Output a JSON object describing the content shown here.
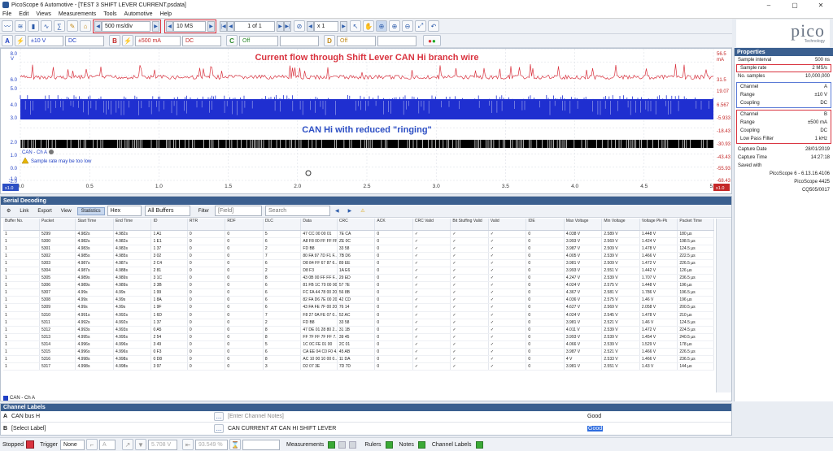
{
  "window": {
    "title": "PicoScope 6 Automotive - [TEST 3 SHIFT LEVER CURRENT.psdata]",
    "minimize": "–",
    "maximize": "▢",
    "close": "✕"
  },
  "menu": [
    "File",
    "Edit",
    "Views",
    "Measurements",
    "Tools",
    "Automotive",
    "Help"
  ],
  "toolbar": {
    "timebase": "500 ms/div",
    "samples": "10 MS",
    "page": "1 of 1",
    "zoom": "x 1"
  },
  "channels": {
    "a": {
      "letter": "A",
      "range": "±10 V",
      "coupling": "DC"
    },
    "b": {
      "letter": "B",
      "range": "±500 mA",
      "coupling": "DC"
    },
    "c": {
      "value": "Off"
    },
    "d": {
      "value": "Off"
    }
  },
  "scope": {
    "title_b": "Current flow through Shift Lever CAN Hi branch wire",
    "title_a": "CAN Hi with reduced \"ringing\"",
    "left_unit": "V",
    "right_unit": "mA",
    "left_ticks": [
      "8.0",
      "6.0",
      "5.0",
      "4.0",
      "3.0",
      "2.0",
      "1.0",
      "0.0",
      "-1.0",
      "-2.0"
    ],
    "right_ticks": [
      "56.5",
      "31.5",
      "19.07",
      "6.567",
      "-5.933",
      "-18.43",
      "-30.93",
      "-43.43",
      "-55.93",
      "-68.43"
    ],
    "x_ticks": [
      "0.0",
      "0.5",
      "1.0",
      "1.5",
      "2.0",
      "2.5",
      "3.0",
      "3.5",
      "4.0",
      "4.5",
      "5.0"
    ],
    "x_unit": "s",
    "decode_label": "CAN - Ch A",
    "warning": "Sample rate may be too low",
    "axis_left_badge": "x1.0",
    "axis_right_badge": "x1.0"
  },
  "logo": {
    "word": "pico",
    "sub": "Technology"
  },
  "properties": {
    "title": "Properties",
    "general": [
      {
        "k": "Sample interval",
        "v": "500 ns"
      },
      {
        "k": "Sample rate",
        "v": "2 MS/s"
      },
      {
        "k": "No. samples",
        "v": "10,000,000"
      }
    ],
    "channel_a": [
      {
        "k": "Channel",
        "v": "A"
      },
      {
        "k": "Range",
        "v": "±10 V"
      },
      {
        "k": "Coupling",
        "v": "DC"
      }
    ],
    "channel_b": [
      {
        "k": "Channel",
        "v": "B"
      },
      {
        "k": "Range",
        "v": "±500 mA"
      },
      {
        "k": "Coupling",
        "v": "DC"
      },
      {
        "k": "Low Pass Filter",
        "v": "1 kHz"
      }
    ],
    "capture": [
      {
        "k": "Capture Date",
        "v": "28/01/2019"
      },
      {
        "k": "Capture Time",
        "v": "14:27:18"
      }
    ],
    "saved_with_label": "Saved with",
    "saved": [
      "PicoScope 6 - 6.13.16.4106",
      "PicoScope 4425",
      "CQ505/0017"
    ]
  },
  "serial": {
    "title": "Serial Decoding",
    "toolbar": {
      "link": "Link",
      "export": "Export",
      "view": "View",
      "statistics": "Statistics",
      "hex": "Hex",
      "buffers": "All Buffers",
      "filter": "Filter",
      "field": "[Field]",
      "search": "Search"
    },
    "columns": [
      "Buffer No.",
      "Packet",
      "Start Time",
      "End Time",
      "ID",
      "RTR",
      "RDF",
      "DLC",
      "Data",
      "CRC",
      "ACK",
      "CRC Valid",
      "Bit Stuffing Valid",
      "Valid",
      "IDE",
      "Max Voltage",
      "Min Voltage",
      "Voltage Pk-Pk",
      "Packet Time"
    ],
    "rows": [
      [
        "1",
        "5299",
        "4.982s",
        "4.982s",
        "1 A1",
        "0",
        "0",
        "5",
        "47 CC 00 00 01",
        "7E CA",
        "0",
        "✓",
        "✓",
        "✓",
        "0",
        "4.038 V",
        "2.589 V",
        "1.448 V",
        "180 µs"
      ],
      [
        "1",
        "5300",
        "4.982s",
        "4.982s",
        "1 E1",
        "0",
        "0",
        "6",
        "A8 F8 00 FF FF FF",
        "ZE 0C",
        "0",
        "✓",
        "✓",
        "✓",
        "0",
        "3.993 V",
        "2.569 V",
        "1.424 V",
        "198.5 µs"
      ],
      [
        "1",
        "5301",
        "4.983s",
        "4.983s",
        "1 37",
        "0",
        "0",
        "2",
        "FD B8",
        "33 58",
        "0",
        "✓",
        "✓",
        "✓",
        "0",
        "3.987 V",
        "2.509 V",
        "1.478 V",
        "124.5 µs"
      ],
      [
        "1",
        "5302",
        "4.985s",
        "4.985s",
        "3 02",
        "0",
        "0",
        "7",
        "80 FA 97 7D F1 F...",
        "7B D6",
        "0",
        "✓",
        "✓",
        "✓",
        "0",
        "4.005 V",
        "2.539 V",
        "1.466 V",
        "222.5 µs"
      ],
      [
        "1",
        "5303",
        "4.987s",
        "4.987s",
        "2 C4",
        "0",
        "0",
        "6",
        "D8 84 FF 67 87 6...",
        "89 EE",
        "0",
        "✓",
        "✓",
        "✓",
        "0",
        "3.981 V",
        "2.509 V",
        "1.472 V",
        "226.5 µs"
      ],
      [
        "1",
        "5304",
        "4.987s",
        "4.988s",
        "2 81",
        "0",
        "0",
        "2",
        "D8 F3",
        "1A E6",
        "0",
        "✓",
        "✓",
        "✓",
        "0",
        "3.993 V",
        "2.551 V",
        "1.442 V",
        "126 µs"
      ],
      [
        "1",
        "5305",
        "4.989s",
        "4.989s",
        "3 1C",
        "0",
        "0",
        "8",
        "43 0B 00 FF FF F...",
        "29 ED",
        "0",
        "✓",
        "✓",
        "✓",
        "0",
        "4.247 V",
        "2.539 V",
        "1.707 V",
        "236.5 µs"
      ],
      [
        "1",
        "5306",
        "4.989s",
        "4.989s",
        "3 3B",
        "0",
        "0",
        "6",
        "81 FB 1C 70 00 00",
        "57 7E",
        "0",
        "✓",
        "✓",
        "✓",
        "0",
        "4.024 V",
        "2.575 V",
        "1.448 V",
        "196 µs"
      ],
      [
        "1",
        "5307",
        "4.99s",
        "4.99s",
        "1 99",
        "0",
        "0",
        "6",
        "FC FA 44 78 00 20",
        "56 8B",
        "0",
        "✓",
        "✓",
        "✓",
        "0",
        "4.367 V",
        "2.581 V",
        "1.786 V",
        "196.5 µs"
      ],
      [
        "1",
        "5308",
        "4.99s",
        "4.99s",
        "1 8A",
        "0",
        "0",
        "6",
        "82 FA D6 7E 00 20",
        "42 CD",
        "0",
        "✓",
        "✓",
        "✓",
        "0",
        "4.036 V",
        "2.575 V",
        "1.46 V",
        "196 µs"
      ],
      [
        "1",
        "5309",
        "4.99s",
        "4.99s",
        "1 9F",
        "0",
        "0",
        "6",
        "43 FA FE 7F 00 20",
        "76 14",
        "0",
        "✓",
        "✓",
        "✓",
        "0",
        "4.627 V",
        "2.569 V",
        "2.058 V",
        "200.5 µs"
      ],
      [
        "1",
        "5310",
        "4.991s",
        "4.992s",
        "1 6D",
        "0",
        "0",
        "7",
        "F8 27 0A FE 07 0...",
        "52 AC",
        "0",
        "✓",
        "✓",
        "✓",
        "0",
        "4.024 V",
        "2.545 V",
        "1.478 V",
        "210 µs"
      ],
      [
        "1",
        "5311",
        "4.992s",
        "4.992s",
        "1 37",
        "0",
        "0",
        "2",
        "FD B8",
        "33 58",
        "0",
        "✓",
        "✓",
        "✓",
        "0",
        "3.981 V",
        "2.521 V",
        "1.46 V",
        "124.5 µs"
      ],
      [
        "1",
        "5312",
        "4.993s",
        "4.993s",
        "0 A5",
        "0",
        "0",
        "8",
        "47 DE 01 28 80 2...",
        "31 1B",
        "0",
        "✓",
        "✓",
        "✓",
        "0",
        "4.011 V",
        "2.539 V",
        "1.472 V",
        "224.5 µs"
      ],
      [
        "1",
        "5313",
        "4.995s",
        "4.995s",
        "2 54",
        "0",
        "0",
        "8",
        "FF 7F FF 7F FF 7...",
        "39 45",
        "0",
        "✓",
        "✓",
        "✓",
        "0",
        "3.993 V",
        "2.539 V",
        "1.454 V",
        "240.5 µs"
      ],
      [
        "1",
        "5314",
        "4.996s",
        "4.996s",
        "3 49",
        "0",
        "0",
        "5",
        "1C 0C FE 01 00",
        "2C 01",
        "0",
        "✓",
        "✓",
        "✓",
        "0",
        "4.066 V",
        "2.539 V",
        "1.529 V",
        "178 µs"
      ],
      [
        "1",
        "5315",
        "4.996s",
        "4.996s",
        "0 F3",
        "0",
        "0",
        "6",
        "CA EE 04 C0 F0 4...",
        "45 AB",
        "0",
        "✓",
        "✓",
        "✓",
        "0",
        "3.987 V",
        "2.521 V",
        "1.466 V",
        "226.5 µs"
      ],
      [
        "1",
        "5316",
        "4.998s",
        "4.998s",
        "0 D8",
        "0",
        "0",
        "8",
        "AC 10 00 10 00 0...",
        "11 DA",
        "0",
        "✓",
        "✓",
        "✓",
        "0",
        "4 V",
        "2.533 V",
        "1.466 V",
        "236.5 µs"
      ],
      [
        "1",
        "5317",
        "4.998s",
        "4.998s",
        "3 97",
        "0",
        "0",
        "3",
        "D2 07 3E",
        "7D 7D",
        "0",
        "✓",
        "✓",
        "✓",
        "0",
        "3.981 V",
        "2.551 V",
        "1.43 V",
        "144 µs"
      ]
    ],
    "tab": "CAN - Ch A"
  },
  "channel_labels": {
    "title": "Channel Labels",
    "rows": [
      {
        "ch": "A",
        "label": "CAN bus H",
        "btn": "...",
        "notes": "[Enter Channel Notes]",
        "status": "Good"
      },
      {
        "ch": "B",
        "label": "[Select Label]",
        "btn": "...",
        "notes": "CAN CURRENT AT CAN HI SHIFT LEVER",
        "status": "Good"
      }
    ]
  },
  "status": {
    "stopped": "Stopped",
    "trigger": "Trigger",
    "trigger_mode": "None",
    "trig_ch": "A",
    "trig_level": "5.708 V",
    "trig_pct": "93.549 %",
    "measurements": "Measurements",
    "rulers": "Rulers",
    "notes": "Notes",
    "channel_labels": "Channel Labels"
  }
}
